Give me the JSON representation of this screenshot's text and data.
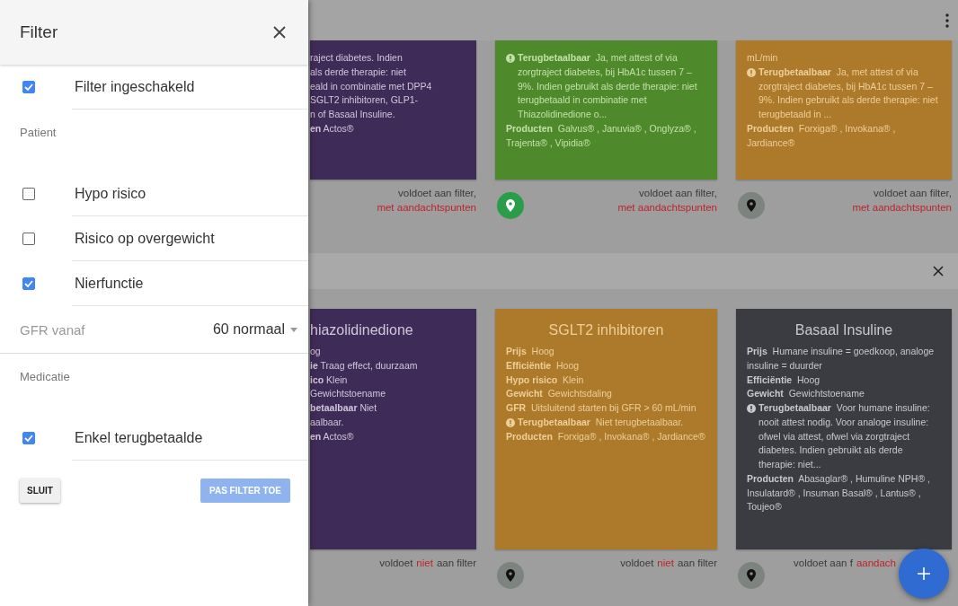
{
  "drawer": {
    "title": "Filter",
    "items": [
      {
        "kind": "checkbox",
        "label": "Filter ingeschakeld",
        "checked": true
      },
      {
        "kind": "subheader",
        "label": "Patient"
      },
      {
        "kind": "checkbox",
        "label": "Hypo risico",
        "checked": false
      },
      {
        "kind": "checkbox",
        "label": "Risico op overgewicht",
        "checked": false
      },
      {
        "kind": "checkbox",
        "label": "Nierfunctie",
        "checked": true
      },
      {
        "kind": "select",
        "label": "GFR vanaf",
        "value": "60 normaal"
      },
      {
        "kind": "subheader",
        "label": "Medicatie"
      },
      {
        "kind": "checkbox",
        "label": "Enkel terugbetaalde",
        "checked": true
      }
    ],
    "buttons": [
      {
        "label": "SLUIT",
        "disabled": false
      },
      {
        "label": "PAS FILTER TOE",
        "disabled": true
      }
    ]
  },
  "sections": [
    {
      "cards": [
        {
          "kind": "partial",
          "color": "#3f2b57",
          "lines": [
            "raject diabetes. Indien",
            "als derde therapie: niet",
            "eald in combinatie met DPP4",
            "SGLT2 inhibitoren, GLP1-",
            "n of Basaal Insuline.",
            "**en** Actos®"
          ],
          "footer": [
            {
              "text": "voldoet aan filter,",
              "alert": false
            },
            {
              "text": "met aandachtspunten",
              "alert": true
            }
          ]
        },
        {
          "kind": "full",
          "color": "#4e8a2c",
          "fields": [
            {
              "label": "Terugbetaalbaar",
              "value": "Ja, met attest of via zorgtraject diabetes, bij HbA1c tussen 7 – 9%. Indien gebruikt als derde therapie: niet terugbetaald in combinatie met Thiazolidinedione o...",
              "info": true
            },
            {
              "label": "Producten",
              "value": "Galvus® , Januvia® , Onglyza® , Trajenta® , Vipidia®",
              "info": false
            }
          ],
          "pin": {
            "active": true
          },
          "footer": [
            {
              "text": "voldoet aan filter,",
              "alert": false
            },
            {
              "text": "met aandachtspunten",
              "alert": true
            }
          ]
        },
        {
          "kind": "full",
          "color": "#ad7a2c",
          "lines": [
            "mL/min"
          ],
          "fields": [
            {
              "label": "Terugbetaalbaar",
              "value": "Ja, met attest of via zorgtraject diabetes, bij HbA1c tussen 7 – 9%. Indien gebruikt als derde therapie: niet terugbetaald in ...",
              "info": true
            },
            {
              "label": "Producten",
              "value": "Forxiga® , Invokana® , Jardiance®",
              "info": false
            }
          ],
          "pin": {
            "active": false
          },
          "footer": [
            {
              "text": "voldoet aan filter,",
              "alert": false
            },
            {
              "text": "met aandachtspunten",
              "alert": true
            }
          ]
        }
      ]
    },
    {
      "cards": [
        {
          "kind": "partial",
          "color": "#3f2b57",
          "title": "hiazolidinedione",
          "lines": [
            "og",
            "**ie** Traag effect, duurzaam",
            "**ico** Klein",
            "Gewichtstoename",
            "**betaalbaar** Niet",
            "aalbaar.",
            "**en** Actos®"
          ],
          "footer": [
            {
              "text": "voldoet",
              "alert": false
            },
            {
              "text": "niet",
              "alert": true
            },
            {
              "text": "aan filter",
              "alert": false
            }
          ]
        },
        {
          "kind": "full",
          "color": "#ad7a2c",
          "title": "SGLT2 inhibitoren",
          "fields": [
            {
              "label": "Prijs",
              "value": "Hoog",
              "info": false
            },
            {
              "label": "Efficiëntie",
              "value": "Hoog",
              "info": false
            },
            {
              "label": "Hypo risico",
              "value": "Klein",
              "info": false
            },
            {
              "label": "Gewicht",
              "value": "Gewichtsdaling",
              "info": false
            },
            {
              "label": "GFR",
              "value": "Uitsluitend starten bij GFR > 60 mL/min",
              "info": false
            },
            {
              "label": "Terugbetaalbaar",
              "value": "Niet terugbetaalbaar.",
              "info": true
            },
            {
              "label": "Producten",
              "value": "Forxiga® , Invokana® , Jardiance®",
              "info": false
            }
          ],
          "pin": {
            "active": false
          },
          "footer": [
            {
              "text": "voldoet",
              "alert": false
            },
            {
              "text": "niet",
              "alert": true
            },
            {
              "text": "aan filter",
              "alert": false
            }
          ]
        },
        {
          "kind": "full",
          "color": "#3b3c42",
          "title": "Basaal Insuline",
          "fields": [
            {
              "label": "Prijs",
              "value": "Humane insuline = goedkoop, analoge insuline = duurder",
              "info": false
            },
            {
              "label": "Efficiëntie",
              "value": "Hoog",
              "info": false
            },
            {
              "label": "Gewicht",
              "value": "Gewichtstoename",
              "info": false
            },
            {
              "label": "Terugbetaalbaar",
              "value": "Voor humane insuline: nooit attest nodig. Voor analoge insuline: ofwel via attest, ofwel via zorgtraject diabetes. Indien gebruikt als derde therapie: niet...",
              "info": true
            },
            {
              "label": "Producten",
              "value": "Abasaglar® , Humuline NPH® , Insulatard® , Insuman Basal® , Lantus® , Toujeo®",
              "info": false
            }
          ],
          "pin": {
            "active": false
          },
          "footer": [
            {
              "text": "voldoet aan f",
              "alert": false
            },
            {
              "text": "aandach",
              "alert": true
            }
          ]
        }
      ]
    }
  ]
}
